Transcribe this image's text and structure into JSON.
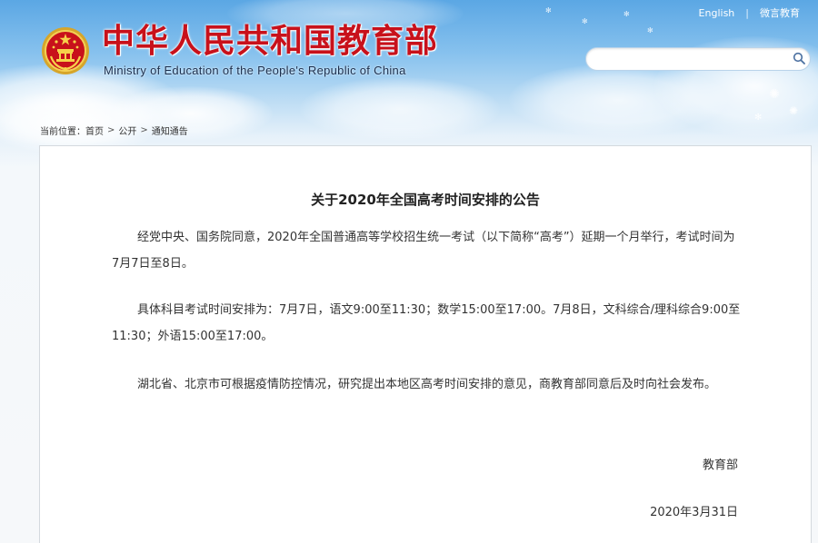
{
  "header": {
    "top_links": {
      "english": "English",
      "separator": "|",
      "weibo": "微言教育"
    },
    "site_title": "中华人民共和国教育部",
    "site_subtitle": "Ministry of Education of the People's Republic of China",
    "search": {
      "placeholder": "",
      "value": ""
    }
  },
  "breadcrumb": {
    "prefix": "当前位置：",
    "items": [
      "首页",
      "公开",
      "通知通告"
    ],
    "separator": ">"
  },
  "article": {
    "title": "关于2020年全国高考时间安排的公告",
    "paragraphs": [
      "经党中央、国务院同意，2020年全国普通高等学校招生统一考试（以下简称“高考”）延期一个月举行，考试时间为7月7日至8日。",
      "具体科目考试时间安排为：7月7日，语文9:00至11:30；数学15:00至17:00。7月8日，文科综合/理科综合9:00至11:30；外语15:00至17:00。",
      "湖北省、北京市可根据疫情防控情况，研究提出本地区高考时间安排的意见，商教育部同意后及时向社会发布。"
    ],
    "signature": "教育部",
    "date": "2020年3月31日"
  },
  "colors": {
    "title_red": "#c8111b",
    "sky_top": "#5ba7e4",
    "page_bg": "#f6f8fa",
    "text": "#333333"
  },
  "icons": {
    "emblem": "national-emblem-icon",
    "search": "search-icon"
  }
}
